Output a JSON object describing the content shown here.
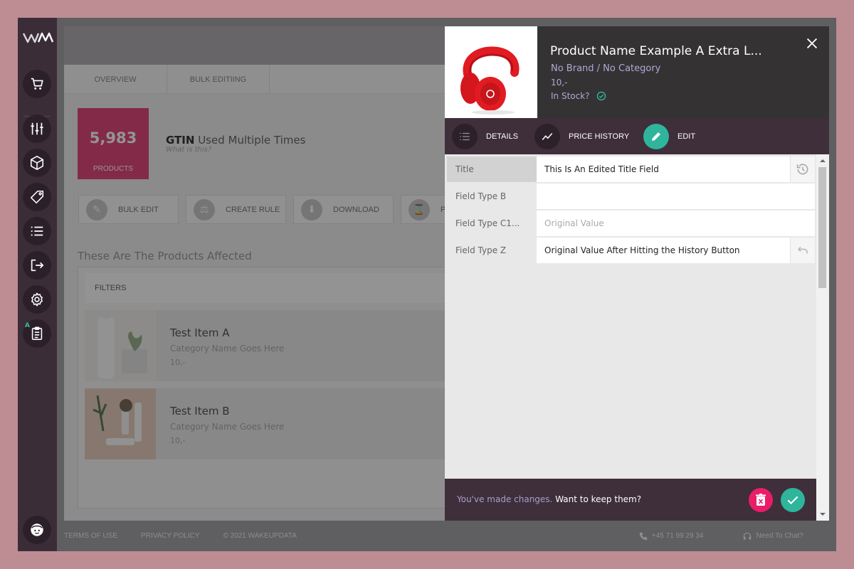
{
  "sidebar": {
    "logo": "WM",
    "items": [
      {
        "icon": "cart-icon"
      },
      {
        "icon": "sliders-icon"
      },
      {
        "icon": "box-icon"
      },
      {
        "icon": "tag-icon"
      },
      {
        "icon": "list-icon"
      },
      {
        "icon": "logout-icon"
      },
      {
        "icon": "gear-icon"
      },
      {
        "icon": "clipboard-icon",
        "badge": "A"
      }
    ],
    "avatar_icon": "face-icon"
  },
  "background": {
    "tabs": [
      "OVERVIEW",
      "BULK EDITIING"
    ],
    "stat": {
      "number": "5,983",
      "label": "PRODUCTS"
    },
    "gtin": {
      "bold": "GTIN",
      "text": "Used Multiple Times",
      "sub": "What is this?"
    },
    "actions": [
      "BULK EDIT",
      "CREATE RULE",
      "DOWNLOAD",
      "PO"
    ],
    "section_title": "These Are The Products Affected",
    "filters_label": "FILTERS",
    "products": [
      {
        "name": "Test Item A",
        "category": "Category Name Goes Here",
        "price": "10,-"
      },
      {
        "name": "Test Item B",
        "category": "Category Name Goes Here",
        "price": "10,-"
      }
    ]
  },
  "footer": {
    "terms": "TERMS OF USE",
    "privacy": "PRIVACY POLICY",
    "copyright": "© 2021 WAKEUPDATA",
    "phone": "+45 71 99 29 34",
    "chat": "Need To Chat?"
  },
  "panel": {
    "title": "Product Name Example A Extra L...",
    "brand_category": "No Brand / No Category",
    "price": "10,-",
    "stock": "In Stock?",
    "tabs": [
      {
        "label": "DETAILS",
        "icon": "list-icon"
      },
      {
        "label": "PRICE HISTORY",
        "icon": "chart-line-icon"
      },
      {
        "label": "EDIT",
        "icon": "pencil-icon"
      }
    ],
    "fields": [
      {
        "label": "Title",
        "value": "This Is An Edited Title Field"
      },
      {
        "label": "Field Type B",
        "value": ""
      },
      {
        "label": "Field Type C1...",
        "placeholder": "Original Value"
      },
      {
        "label": "Field Type Z",
        "value": "Original Value After Hitting the History Button"
      }
    ],
    "save_bar": {
      "prompt": "You've made changes.",
      "question": "Want to keep them?"
    }
  },
  "colors": {
    "accent_teal": "#2fb59b",
    "accent_pink": "#ea1d69",
    "sidebar_bg": "#3b2d38",
    "header_bg": "#353234",
    "muted_purple": "#a99fcb"
  }
}
